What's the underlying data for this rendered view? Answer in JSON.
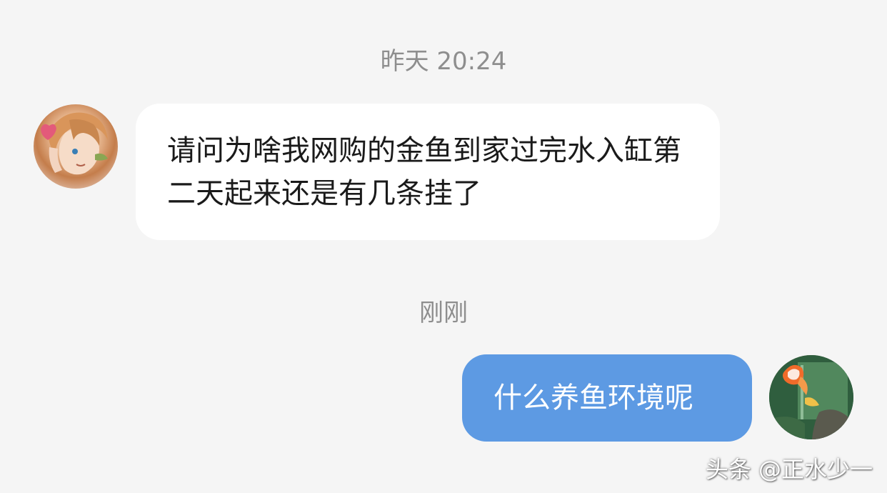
{
  "chat": {
    "messages": [
      {
        "timestamp": "昨天 20:24",
        "sender": "other",
        "avatar_icon": "anime-character-avatar-icon",
        "text": "请问为啥我网购的金鱼到家过完水入缸第二天起来还是有几条挂了"
      },
      {
        "timestamp": "刚刚",
        "sender": "self",
        "avatar_icon": "goldfish-tank-avatar-icon",
        "text": "什么养鱼环境呢"
      }
    ]
  },
  "watermark": {
    "text": "头条 @正水少一"
  },
  "colors": {
    "background": "#f5f5f5",
    "incoming_bubble": "#ffffff",
    "outgoing_bubble": "#5d9ae3",
    "timestamp_text": "#8e8e8e"
  }
}
